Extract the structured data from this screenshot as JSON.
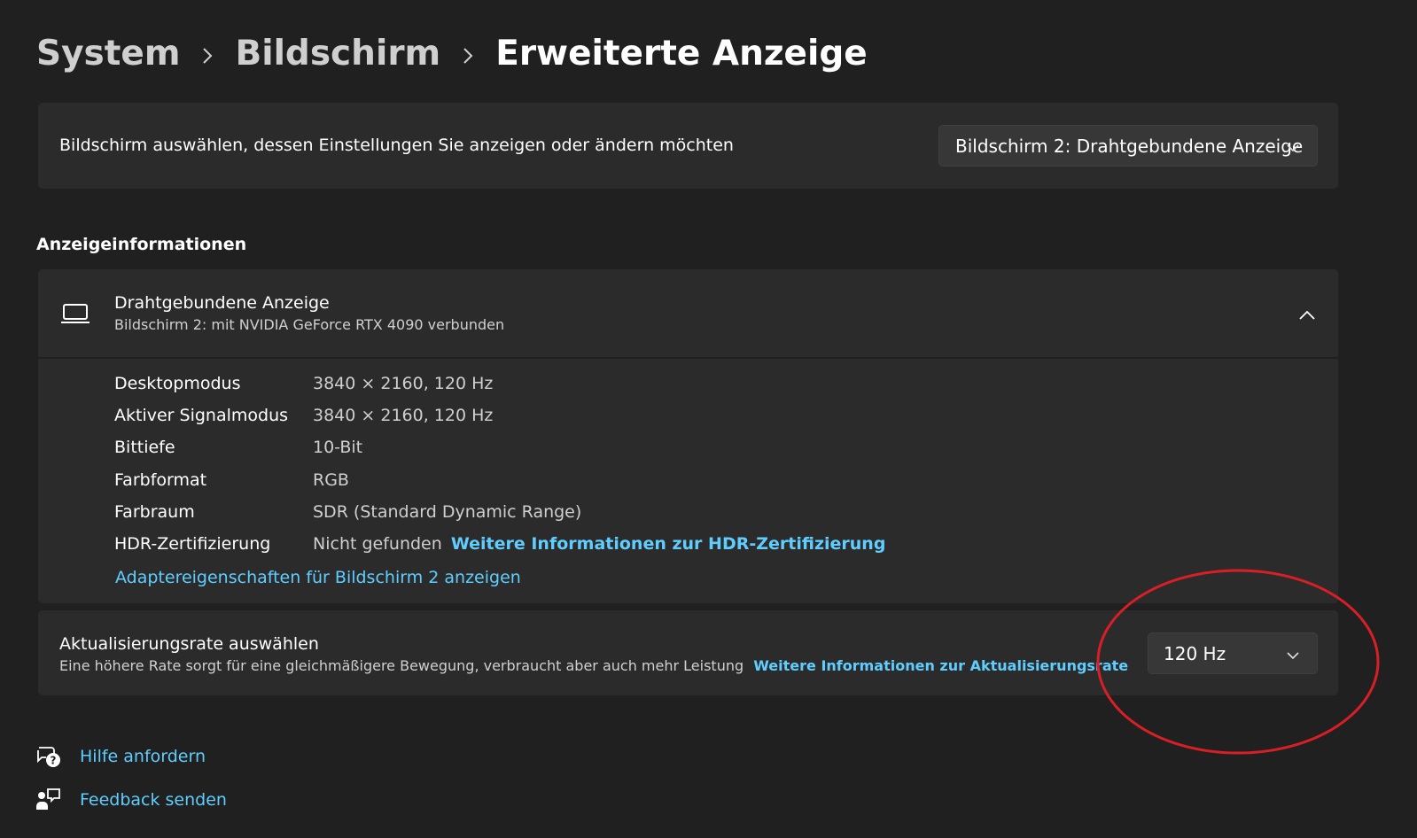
{
  "breadcrumb": {
    "items": [
      "System",
      "Bildschirm",
      "Erweiterte Anzeige"
    ],
    "separator_icon": "chevron-right-icon"
  },
  "display_selector": {
    "label": "Bildschirm auswählen, dessen Einstellungen Sie anzeigen oder ändern möchten",
    "selected": "Bildschirm 2: Drahtgebundene Anzeige"
  },
  "display_info": {
    "section_title": "Anzeigeinformationen",
    "device_icon": "laptop-icon",
    "device_title": "Drahtgebundene Anzeige",
    "device_subtitle": "Bildschirm 2: mit NVIDIA GeForce RTX 4090 verbunden",
    "expanded": true,
    "rows": [
      {
        "label": "Desktopmodus",
        "value": "3840 × 2160, 120 Hz"
      },
      {
        "label": "Aktiver Signalmodus",
        "value": "3840 × 2160, 120 Hz"
      },
      {
        "label": "Bittiefe",
        "value": "10-Bit"
      },
      {
        "label": "Farbformat",
        "value": "RGB"
      },
      {
        "label": "Farbraum",
        "value": "SDR (Standard Dynamic Range)"
      },
      {
        "label": "HDR-Zertifizierung",
        "value": "Nicht gefunden",
        "link": "Weitere Informationen zur HDR-Zertifizierung"
      }
    ],
    "adapter_link": "Adaptereigenschaften für Bildschirm 2 anzeigen"
  },
  "refresh_rate": {
    "title": "Aktualisierungsrate auswählen",
    "description": "Eine höhere Rate sorgt für eine gleichmäßigere Bewegung, verbraucht aber auch mehr Leistung",
    "link": "Weitere Informationen zur Aktualisierungsrate",
    "selected": "120 Hz"
  },
  "footer": {
    "help": {
      "label": "Hilfe anfordern",
      "icon": "help-chat-icon"
    },
    "feedback": {
      "label": "Feedback senden",
      "icon": "feedback-icon"
    }
  },
  "colors": {
    "background": "#202020",
    "card": "#2b2b2b",
    "accent_link": "#60cdff",
    "annotation": "#d81f26"
  }
}
